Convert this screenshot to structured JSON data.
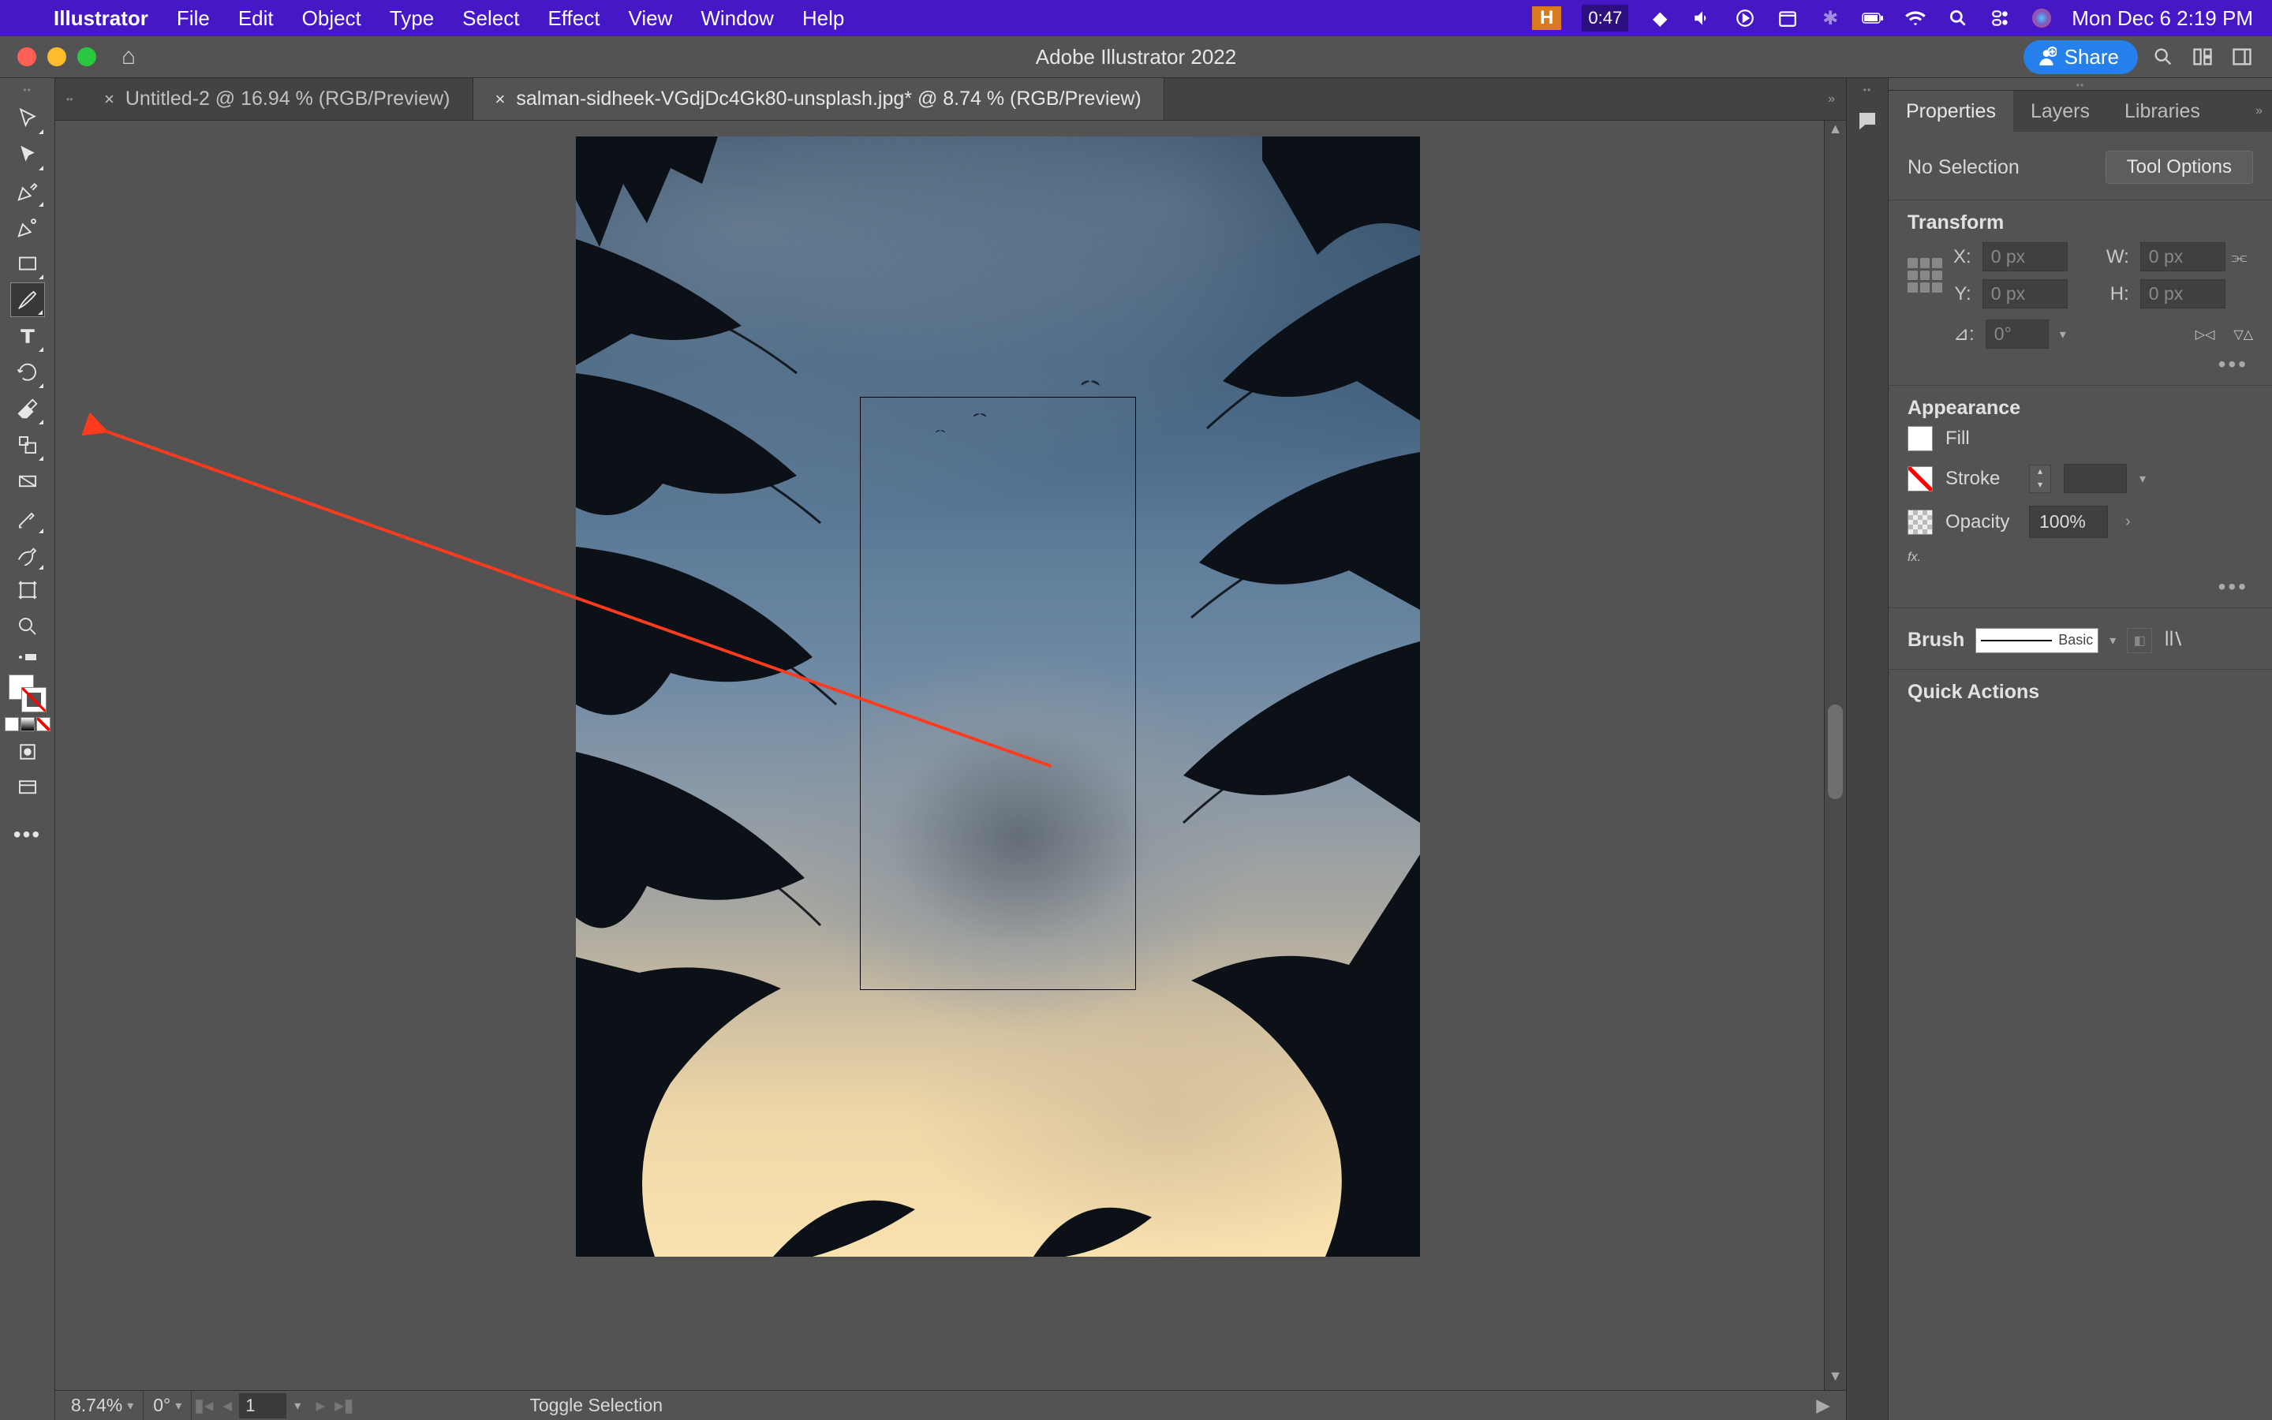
{
  "menubar": {
    "apple": "",
    "appname": "Illustrator",
    "items": [
      "File",
      "Edit",
      "Object",
      "Type",
      "Select",
      "Effect",
      "View",
      "Window",
      "Help"
    ],
    "h_badge": "H",
    "timer": "0:47",
    "clock": "Mon Dec 6  2:19 PM"
  },
  "apptitle": {
    "title": "Adobe Illustrator 2022",
    "share": "Share"
  },
  "doc_tabs": [
    {
      "label": "Untitled-2 @ 16.94 % (RGB/Preview)",
      "active": false
    },
    {
      "label": "salman-sidheek-VGdjDc4Gk80-unsplash.jpg* @ 8.74 % (RGB/Preview)",
      "active": true
    }
  ],
  "statusbar": {
    "zoom": "8.74%",
    "rotate": "0°",
    "artboard": "1",
    "toggle": "Toggle Selection"
  },
  "panel_tabs": [
    "Properties",
    "Layers",
    "Libraries"
  ],
  "properties": {
    "selection_state": "No Selection",
    "tool_options_btn": "Tool Options",
    "transform": {
      "title": "Transform",
      "x_label": "X:",
      "y_label": "Y:",
      "w_label": "W:",
      "h_label": "H:",
      "x": "0 px",
      "y": "0 px",
      "w": "0 px",
      "h": "0 px",
      "rotate_label": "⊿:",
      "rotate": "0°"
    },
    "appearance": {
      "title": "Appearance",
      "fill_label": "Fill",
      "stroke_label": "Stroke",
      "opacity_label": "Opacity",
      "opacity": "100%",
      "fx_label": "fx."
    },
    "brush": {
      "title": "Brush",
      "preset": "Basic"
    },
    "quick_actions": "Quick Actions"
  }
}
